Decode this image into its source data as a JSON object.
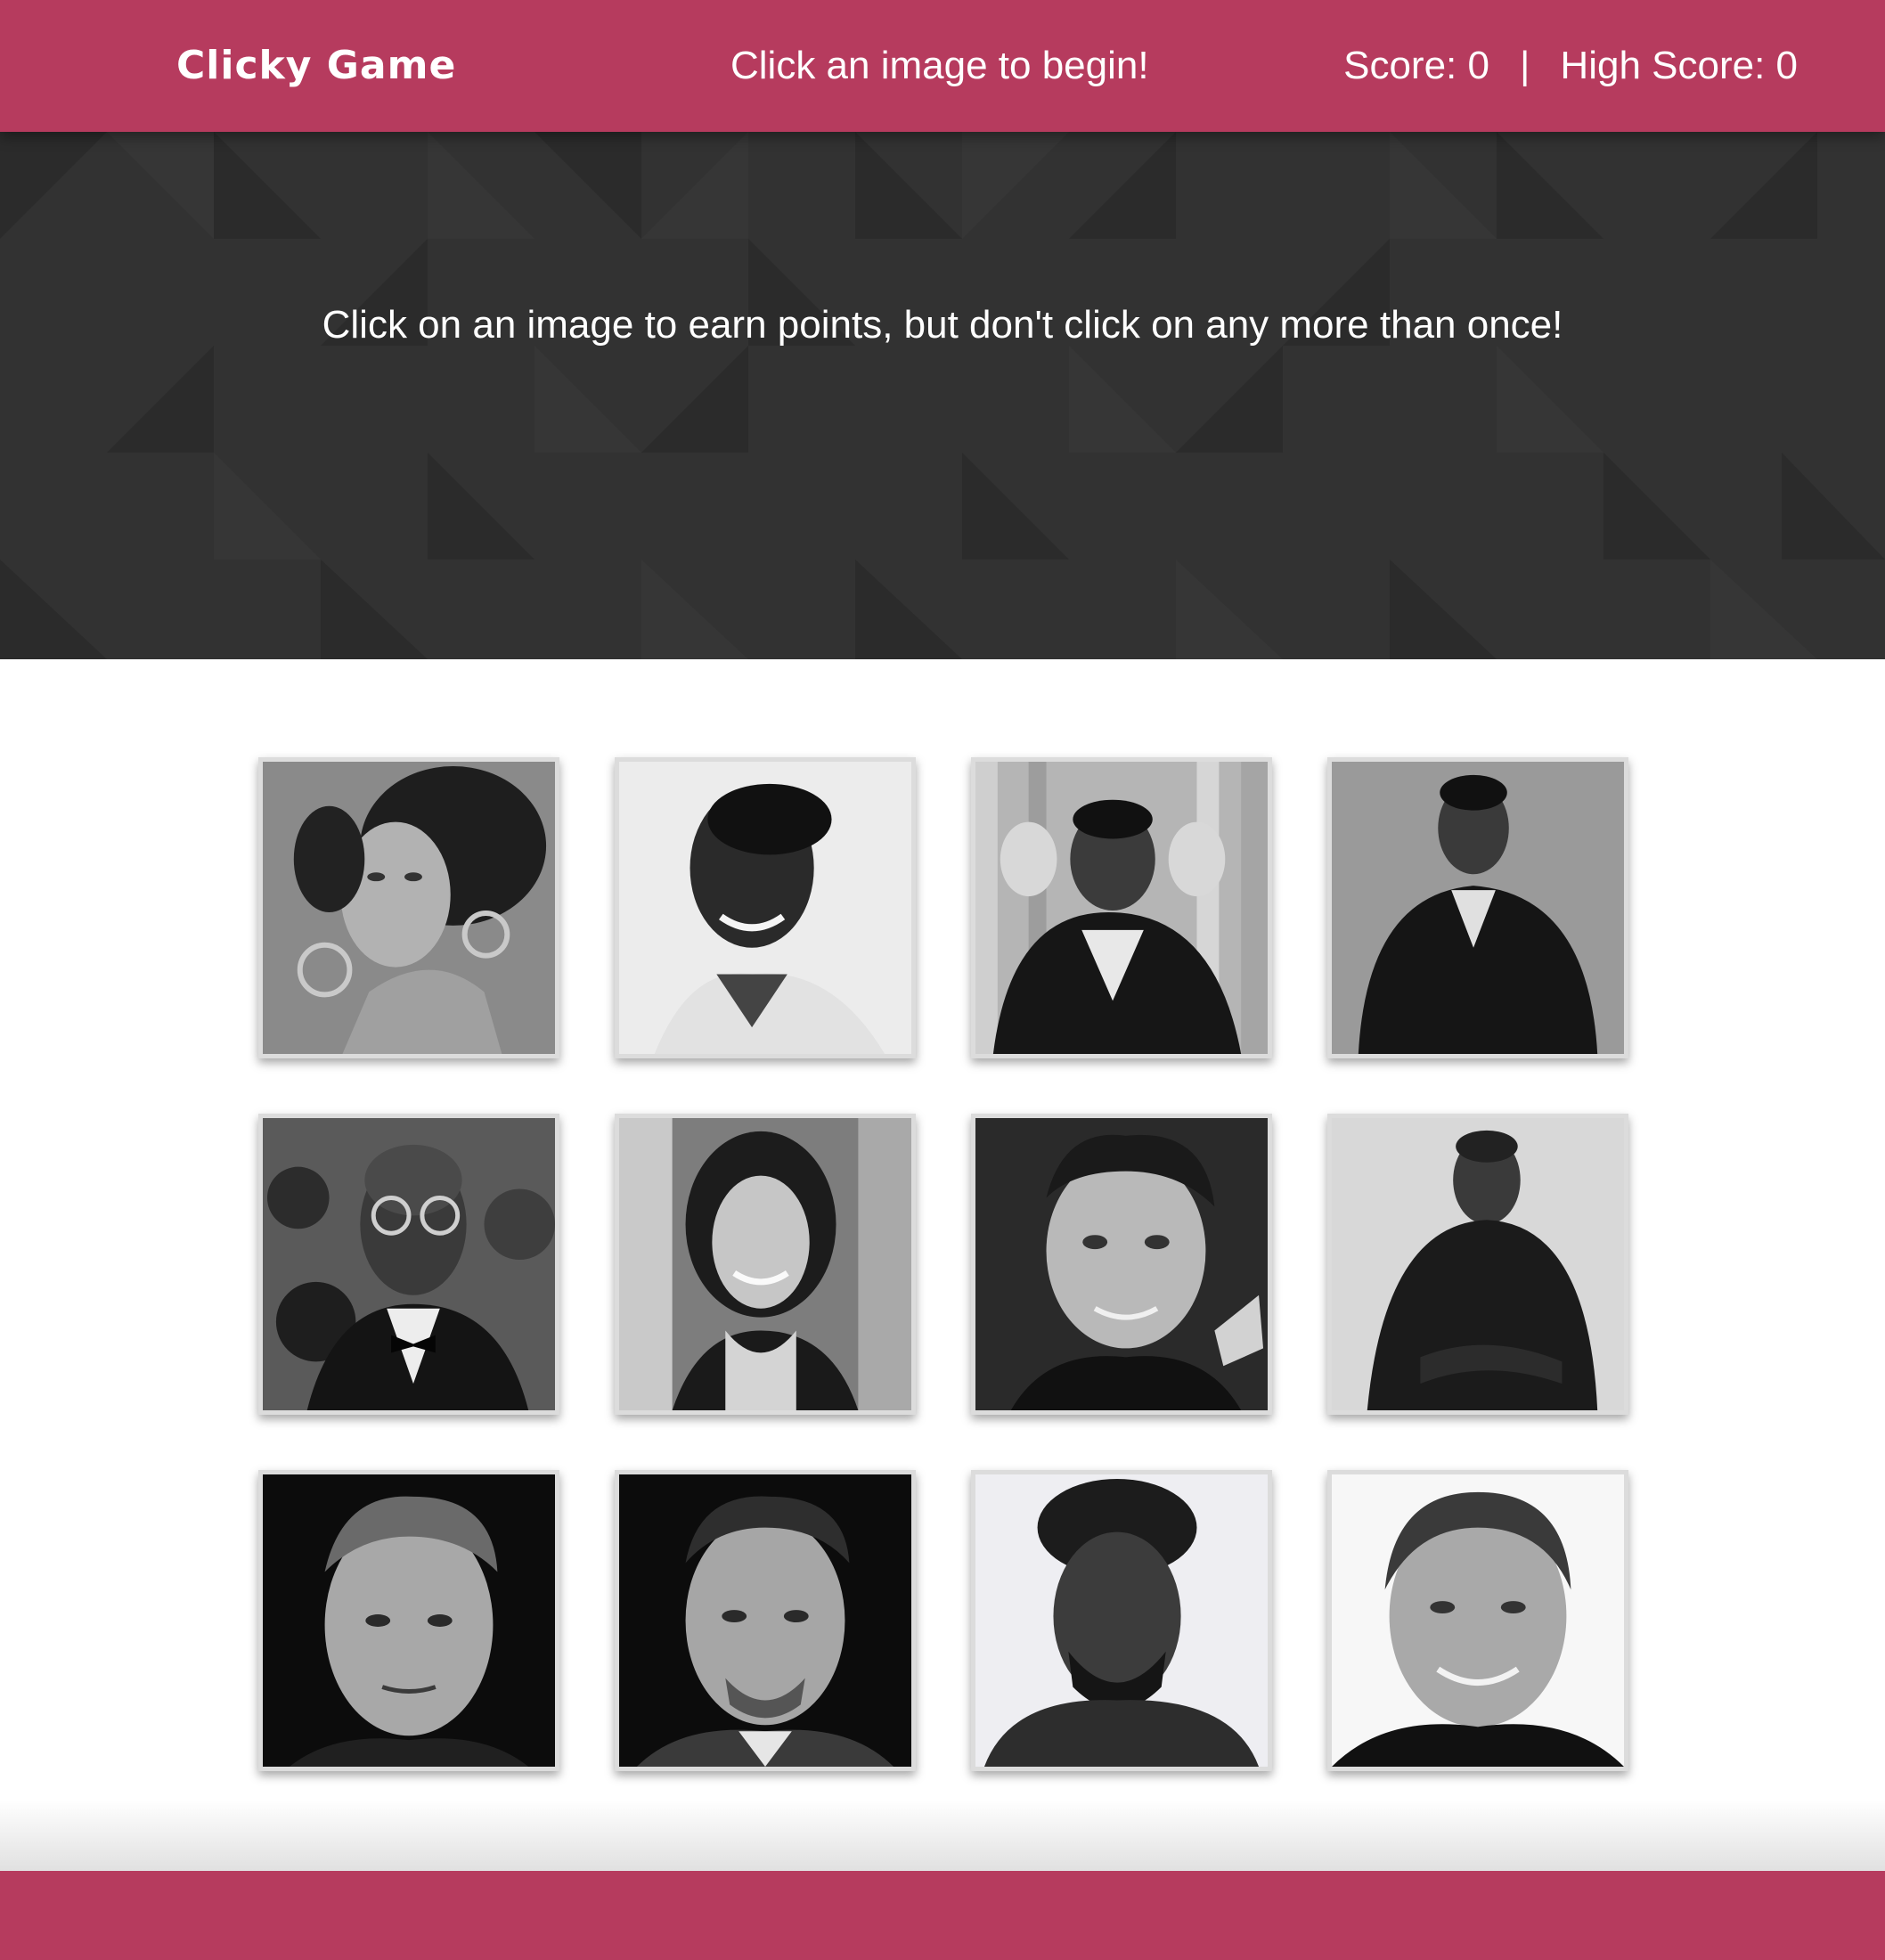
{
  "navbar": {
    "brand": "Clicky Game",
    "status_message": "Click an image to begin!",
    "score_label": "Score: 0",
    "separator": "|",
    "high_score_label": "High Score: 0"
  },
  "hero": {
    "instructions": "Click on an image to earn points, but don't click on any more than once!"
  },
  "cards": [
    {
      "alt": "woman-with-hoop-earrings",
      "tone": "mid"
    },
    {
      "alt": "smiling-man-white-shirt",
      "tone": "light"
    },
    {
      "alt": "man-hands-framing-face",
      "tone": "wood"
    },
    {
      "alt": "man-in-dark-suit",
      "tone": "mid"
    },
    {
      "alt": "bald-man-glasses-bowtie",
      "tone": "crowd"
    },
    {
      "alt": "smiling-woman-dark-hair",
      "tone": "crowd"
    },
    {
      "alt": "man-short-spiky-hair",
      "tone": "dark"
    },
    {
      "alt": "man-dark-shirt-seated",
      "tone": "light"
    },
    {
      "alt": "man-blond-hair-portrait",
      "tone": "black"
    },
    {
      "alt": "man-slicked-hair-beard",
      "tone": "black"
    },
    {
      "alt": "man-curly-hair-beard",
      "tone": "white"
    },
    {
      "alt": "smiling-man-white-background",
      "tone": "white"
    }
  ],
  "colors": {
    "navbar": "#b63b5e",
    "hero": "#323232",
    "footer": "#b63b5e",
    "card_border": "#dcdcdc"
  }
}
